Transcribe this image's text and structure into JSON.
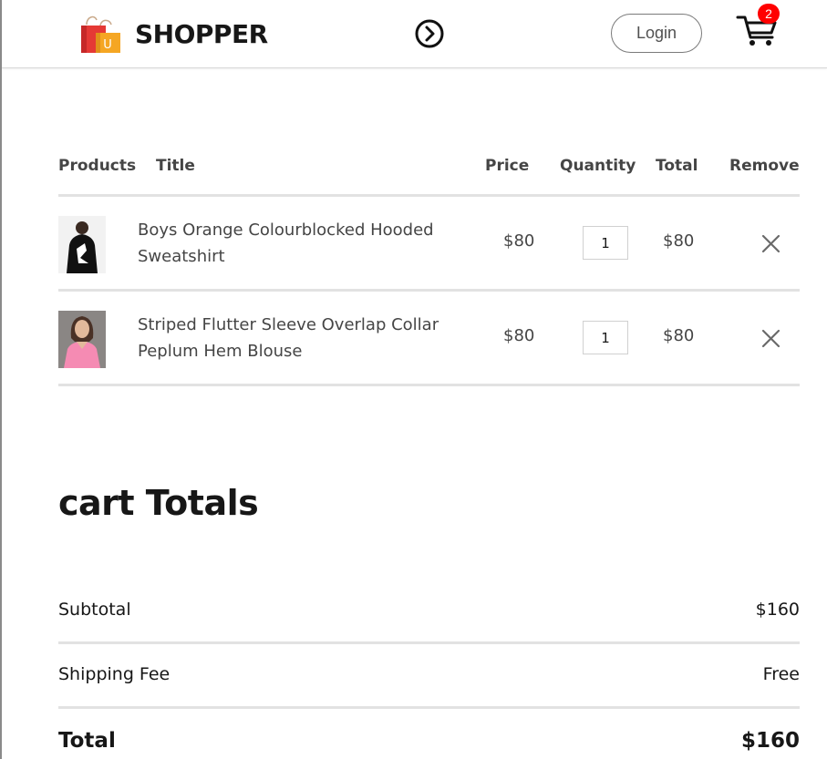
{
  "navbar": {
    "brand": "SHOPPER",
    "logo_letter": "U",
    "login_label": "Login",
    "cart_count": "2"
  },
  "cart_table": {
    "headers": [
      "Products",
      "Title",
      "Price",
      "Quantity",
      "Total",
      "Remove"
    ],
    "items": [
      {
        "title": "Boys Orange Colourblocked Hooded Sweatshirt",
        "price": "$80",
        "quantity": "1",
        "total": "$80",
        "image": "boy-hoodie-photo"
      },
      {
        "title": "Striped Flutter Sleeve Overlap Collar Peplum Hem Blouse",
        "price": "$80",
        "quantity": "1",
        "total": "$80",
        "image": "woman-pink-blouse-photo"
      }
    ]
  },
  "cart_totals": {
    "heading": "cart Totals",
    "subtotal_label": "Subtotal",
    "subtotal_value": "$160",
    "shipping_label": "Shipping Fee",
    "shipping_value": "Free",
    "total_label": "Total",
    "total_value": "$160"
  },
  "colors": {
    "badge": "#ff0000",
    "text_dark": "#171717",
    "text_muted": "#454545",
    "divider": "#e2e2e2"
  }
}
